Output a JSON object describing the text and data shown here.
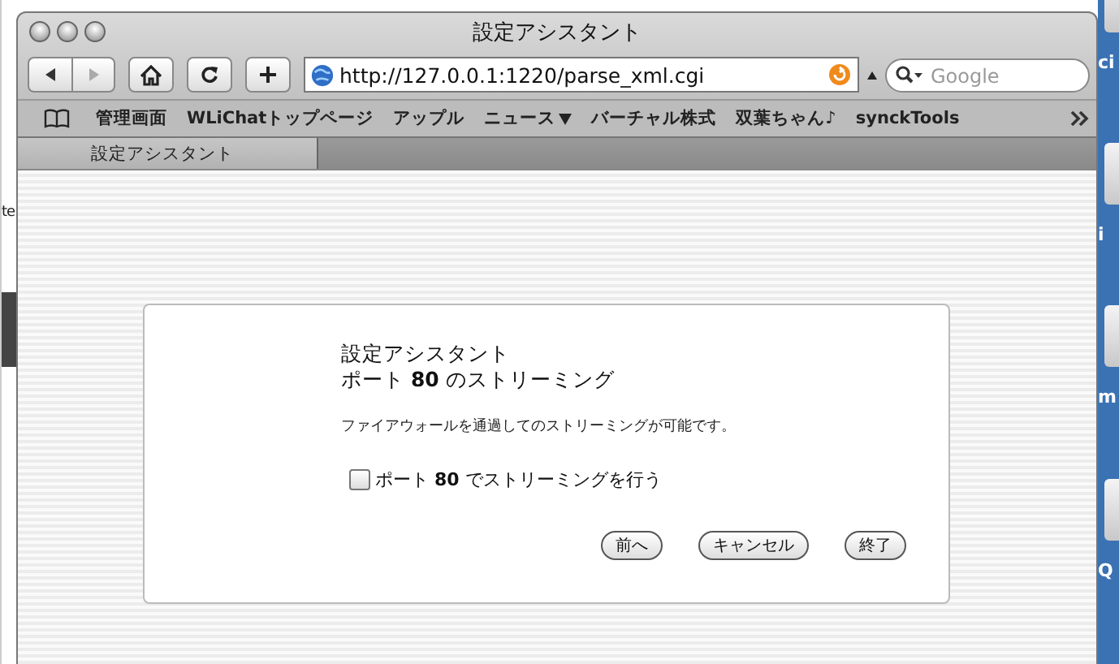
{
  "background_window": {
    "text": "te"
  },
  "desktop": {
    "labels": [
      "ci",
      "i",
      "m",
      "Q"
    ]
  },
  "window": {
    "title": "設定アシスタント"
  },
  "toolbar": {
    "url": "http://127.0.0.1:1220/parse_xml.cgi",
    "search": {
      "placeholder": "Google"
    }
  },
  "bookmarks": [
    {
      "label": "管理画面",
      "kind": "link"
    },
    {
      "label": "WLiChatトップページ",
      "kind": "link"
    },
    {
      "label": "アップル",
      "kind": "link"
    },
    {
      "label": "ニュース",
      "kind": "menu"
    },
    {
      "label": "バーチャル株式",
      "kind": "link"
    },
    {
      "label": "双葉ちゃん♪",
      "kind": "link"
    },
    {
      "label": "synckTools",
      "kind": "link"
    }
  ],
  "tabs": [
    {
      "label": "設定アシスタント",
      "selected": true
    }
  ],
  "dialog": {
    "heading": "設定アシスタント",
    "subheading": "ポート **80** のストリーミング",
    "description": "ファイアウォールを通過してのストリーミングが可能です。",
    "option": {
      "label": "ポート **80** でストリーミングを行う",
      "checked": false
    },
    "buttons": [
      "前へ",
      "キャンセル",
      "終了"
    ]
  }
}
